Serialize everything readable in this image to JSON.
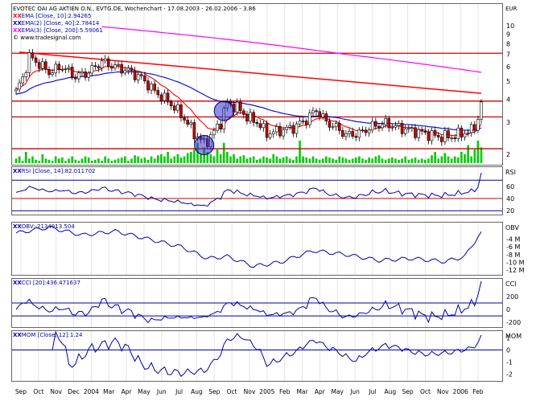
{
  "header": {
    "title": "EVOTEC OAI AG AKTIEN O.N., EVTG.DE, Wochenchart - 17.08.2003 - 26.02.2006 - 3.86",
    "currency": "EUR",
    "legend": [
      {
        "label": "EMA [Close, 10]:2.94265",
        "color": "#ff0000"
      },
      {
        "label": "EMA(2) [Close, 40]:2.78414",
        "color": "#0000cc"
      },
      {
        "label": "EMA(3) [Close, 200]:5.59061",
        "color": "#ff00ff"
      }
    ],
    "copyright": "© www.tradesignal.com"
  },
  "x_axis_labels": [
    "Sep",
    "Oct",
    "Nov",
    "Dec",
    "2004",
    "Mar",
    "Apr",
    "May",
    "Jun",
    "Jul",
    "Aug",
    "Sep",
    "Oct",
    "Nov",
    "2005",
    "Feb",
    "Mar",
    "Apr",
    "May",
    "Jun",
    "Jul",
    "Aug",
    "Sep",
    "Oct",
    "Nov",
    "2006",
    "Feb"
  ],
  "colors": {
    "price_up": "#ffffff",
    "price_down": "#cc0000",
    "volume": "#00cc00",
    "ema10": "#ff0000",
    "ema40": "#0000cc",
    "ema200": "#ff00ff",
    "indicator": "#0000aa",
    "trendline": "#ff0000",
    "circle": "#3333cc"
  },
  "chart_data": [
    {
      "panel": "price",
      "type": "candlestick",
      "title": "EVOTEC OAI AG AKTIEN O.N., EVTG.DE, Wochenchart - 17.08.2003 - 26.02.2006 - 3.86",
      "ylabel": "EUR",
      "y_scale": "log",
      "y_ticks": [
        2,
        3,
        4,
        5,
        6,
        7,
        8,
        9,
        10
      ],
      "ylim": [
        1.85,
        12.5
      ],
      "close_anchors": [
        [
          0,
          4.4
        ],
        [
          2,
          5.2
        ],
        [
          4,
          6.8
        ],
        [
          7,
          6.2
        ],
        [
          10,
          5.6
        ],
        [
          14,
          6.0
        ],
        [
          18,
          5.3
        ],
        [
          22,
          5.6
        ],
        [
          26,
          6.4
        ],
        [
          30,
          6.0
        ],
        [
          34,
          5.7
        ],
        [
          38,
          5.2
        ],
        [
          42,
          4.4
        ],
        [
          46,
          3.9
        ],
        [
          50,
          3.3
        ],
        [
          54,
          2.6
        ],
        [
          57,
          2.3
        ],
        [
          59,
          2.5
        ],
        [
          62,
          3.0
        ],
        [
          64,
          3.8
        ],
        [
          67,
          3.6
        ],
        [
          70,
          3.2
        ],
        [
          73,
          3.0
        ],
        [
          76,
          2.6
        ],
        [
          80,
          2.7
        ],
        [
          84,
          2.8
        ],
        [
          88,
          3.1
        ],
        [
          91,
          3.5
        ],
        [
          94,
          3.0
        ],
        [
          97,
          2.8
        ],
        [
          100,
          2.55
        ],
        [
          104,
          2.6
        ],
        [
          108,
          2.85
        ],
        [
          112,
          2.95
        ],
        [
          116,
          2.8
        ],
        [
          120,
          2.7
        ],
        [
          124,
          2.6
        ],
        [
          128,
          2.5
        ],
        [
          132,
          2.5
        ],
        [
          135,
          2.6
        ],
        [
          138,
          2.7
        ],
        [
          140,
          3.1
        ],
        [
          141,
          3.86
        ]
      ],
      "volume_heights": [
        0.2,
        0.3,
        0.1,
        0.5,
        0.2,
        0.3,
        0.15,
        0.1,
        0.4,
        0.2,
        0.15,
        0.1,
        0.3,
        0.2,
        0.25,
        0.1,
        0.2,
        0.3,
        0.15,
        0.1,
        0.2,
        0.3,
        0.25,
        0.1,
        0.15,
        0.2,
        0.1,
        0.3,
        0.2,
        0.1,
        0.15,
        0.2,
        0.25,
        0.3,
        0.1,
        0.2,
        0.35,
        0.3,
        0.2,
        0.25,
        0.15,
        0.3,
        0.2,
        0.35,
        0.4,
        0.3,
        0.5,
        0.2,
        0.3,
        0.4,
        0.25,
        0.3,
        0.45,
        0.5,
        0.6,
        0.9,
        0.4,
        0.7,
        0.5,
        0.4,
        0.3,
        0.6,
        0.4,
        0.9,
        0.5,
        0.3,
        0.4,
        0.2,
        0.3,
        0.35,
        0.2,
        0.25,
        0.3,
        0.15,
        0.2,
        0.3,
        0.25,
        0.2,
        0.4,
        0.3,
        0.2,
        0.25,
        0.3,
        0.2,
        0.15,
        0.3,
        1.0,
        0.3,
        0.25,
        0.2,
        0.3,
        0.2,
        0.15,
        0.2,
        0.3,
        0.25,
        0.2,
        0.15,
        0.3,
        0.25,
        0.2,
        0.15,
        0.2,
        0.25,
        0.3,
        0.2,
        0.15,
        0.25,
        0.2,
        0.3,
        0.35,
        0.2,
        0.15,
        0.2,
        0.25,
        0.2,
        0.15,
        0.2,
        0.3,
        0.15,
        0.2,
        0.25,
        0.15,
        0.2,
        0.15,
        0.2,
        0.35,
        0.5,
        0.2,
        0.3,
        0.45,
        0.3,
        0.2,
        0.3,
        0.25,
        0.5,
        0.4,
        0.8,
        0.3,
        0.6,
        1.0,
        0.7
      ],
      "support_lines": [
        2.15,
        3.2,
        3.9,
        7.1
      ],
      "trendline": [
        [
          1,
          7.2
        ],
        [
          141,
          4.3
        ]
      ],
      "ema200_anchors": [
        [
          26,
          9.9
        ],
        [
          60,
          8.6
        ],
        [
          100,
          7.0
        ],
        [
          141,
          5.59
        ]
      ],
      "last_values": {
        "ema10": 2.94265,
        "ema40": 2.78414,
        "ema200": 5.59061
      }
    },
    {
      "panel": "rsi",
      "type": "line",
      "title": "RSI [Close, 14]:82.011702",
      "y_ticks": [
        20,
        40,
        60
      ],
      "ylim": [
        15,
        90
      ],
      "level_lines": [
        20,
        40,
        70
      ],
      "last_value": 82.011702
    },
    {
      "panel": "obv",
      "type": "line",
      "title": "OBV:-2134013.504",
      "y_ticks": [
        -4,
        -6,
        -8,
        -10,
        -12
      ],
      "y_unit": "M",
      "ylim": [
        -13,
        0
      ],
      "last_value": -2134013.504
    },
    {
      "panel": "cci",
      "type": "line",
      "title": "CCI [20]:436.471637",
      "y_ticks": [
        200,
        0,
        -200
      ],
      "ylim": [
        -260,
        460
      ],
      "level_lines": [
        100,
        -100
      ],
      "last_value": 436.471637
    },
    {
      "panel": "mom",
      "type": "line",
      "title": "MOM [Close, 12]:1.24",
      "y_ticks": [
        1,
        0,
        -1,
        -2
      ],
      "ylim": [
        -2.5,
        1.5
      ],
      "level_lines": [
        0
      ],
      "last_value": 1.24
    }
  ]
}
